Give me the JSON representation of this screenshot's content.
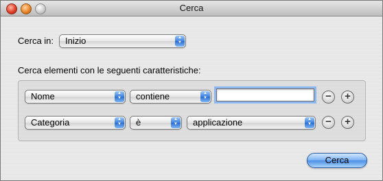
{
  "window": {
    "title": "Cerca"
  },
  "search_in": {
    "label": "Cerca in:",
    "value": "Inizio"
  },
  "criteria": {
    "heading": "Cerca elementi con le seguenti caratteristiche:",
    "rows": [
      {
        "attribute": "Nome",
        "operator": "contiene",
        "value": ""
      },
      {
        "attribute": "Categoria",
        "operator": "è",
        "value": "applicazione"
      }
    ],
    "remove_symbol": "−",
    "add_symbol": "+"
  },
  "actions": {
    "search_label": "Cerca"
  },
  "icons": {
    "close": "close-icon",
    "minimize": "minimize-icon",
    "zoom": "zoom-icon",
    "popup_arrows": "chevron-updown-icon"
  },
  "colors": {
    "accent": "#3c82e0",
    "focus_ring": "#8eb7f0"
  }
}
